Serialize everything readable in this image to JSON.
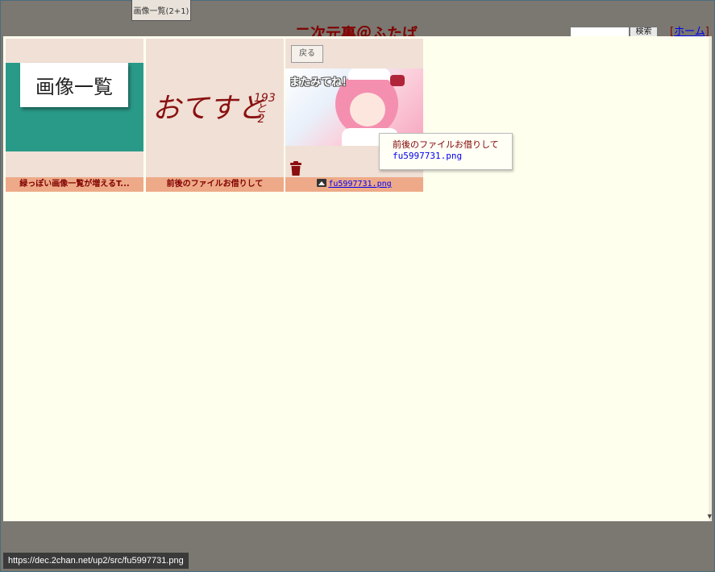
{
  "top_tab": {
    "label": "画像一覧(2+1)"
  },
  "header": {
    "title": "二次元裏＠ふたば",
    "search_button": "検索",
    "home_bracket_open": "[",
    "home_link": "ホーム",
    "home_bracket_close": "]"
  },
  "gallery": {
    "items": [
      {
        "image_text": "画像一覧",
        "caption": "緑っぽい画像一覧が増えるT..."
      },
      {
        "image_text": "おてすと",
        "image_side": "193と2",
        "caption": "前後のファイルお借りして"
      },
      {
        "back_label": "戻る",
        "image_text": "またみてね！",
        "caption": "fu5997731.png",
        "icons": [
          "trash-icon",
          "image-icon"
        ]
      }
    ]
  },
  "tooltip": {
    "line1": "前後のファイルお借りして",
    "line2": "fu5997731.png"
  },
  "statusbar": {
    "url": "https://dec.2chan.net/up2/src/fu5997731.png"
  },
  "colors": {
    "caption_bg": "#eeaa88",
    "thumb_bg": "#f0e0d6",
    "overlay_bg": "#ffffee",
    "text_maroon": "#800000",
    "link_blue": "#0000ee"
  }
}
